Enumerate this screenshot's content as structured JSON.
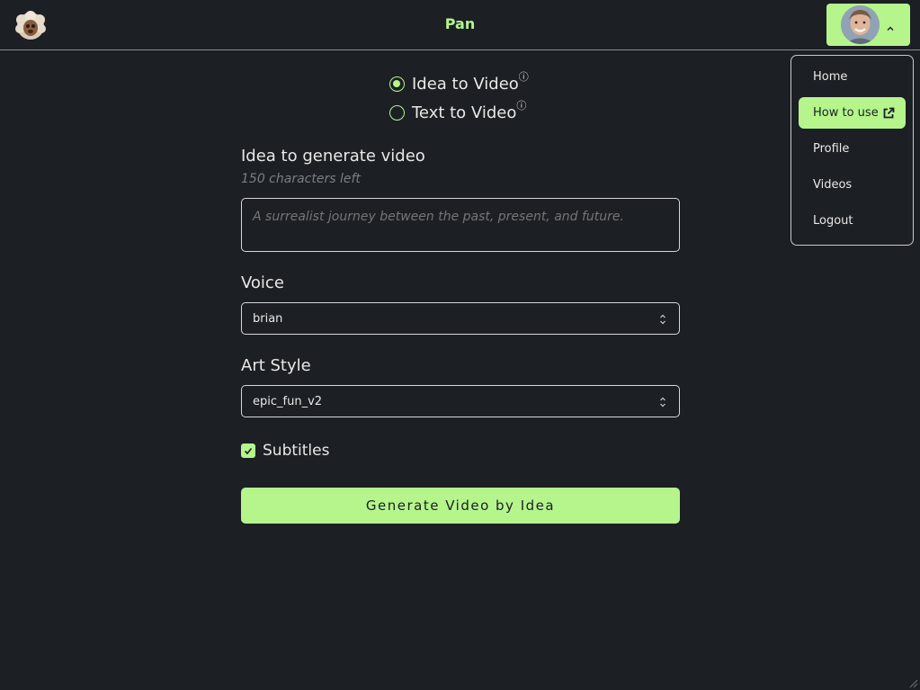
{
  "header": {
    "title": "Pan",
    "logo_icon": "sheep-logo-icon",
    "user_avatar_icon": "avatar-photo",
    "menu_toggle_icon": "chevron-up-icon"
  },
  "menu": {
    "items": [
      {
        "label": "Home"
      },
      {
        "label": "How to use",
        "icon": "external-link-icon",
        "active": true
      },
      {
        "label": "Profile"
      },
      {
        "label": "Videos"
      },
      {
        "label": "Logout"
      }
    ]
  },
  "mode": {
    "options": [
      {
        "label": "Idea to Video",
        "info": "ⓘ",
        "selected": true
      },
      {
        "label": "Text to Video",
        "info": "ⓘ",
        "selected": false
      }
    ]
  },
  "idea": {
    "label": "Idea to generate video",
    "chars_left": "150 characters left",
    "placeholder": "A surrealist journey between the past, present, and future.",
    "value": ""
  },
  "voice": {
    "label": "Voice",
    "selected": "brian"
  },
  "art_style": {
    "label": "Art Style",
    "selected": "epic_fun_v2"
  },
  "subtitles": {
    "label": "Subtitles",
    "checked": true
  },
  "generate_button": {
    "label": "Generate Video by Idea"
  },
  "colors": {
    "accent": "#b5f58c",
    "background": "#1c1f24"
  }
}
